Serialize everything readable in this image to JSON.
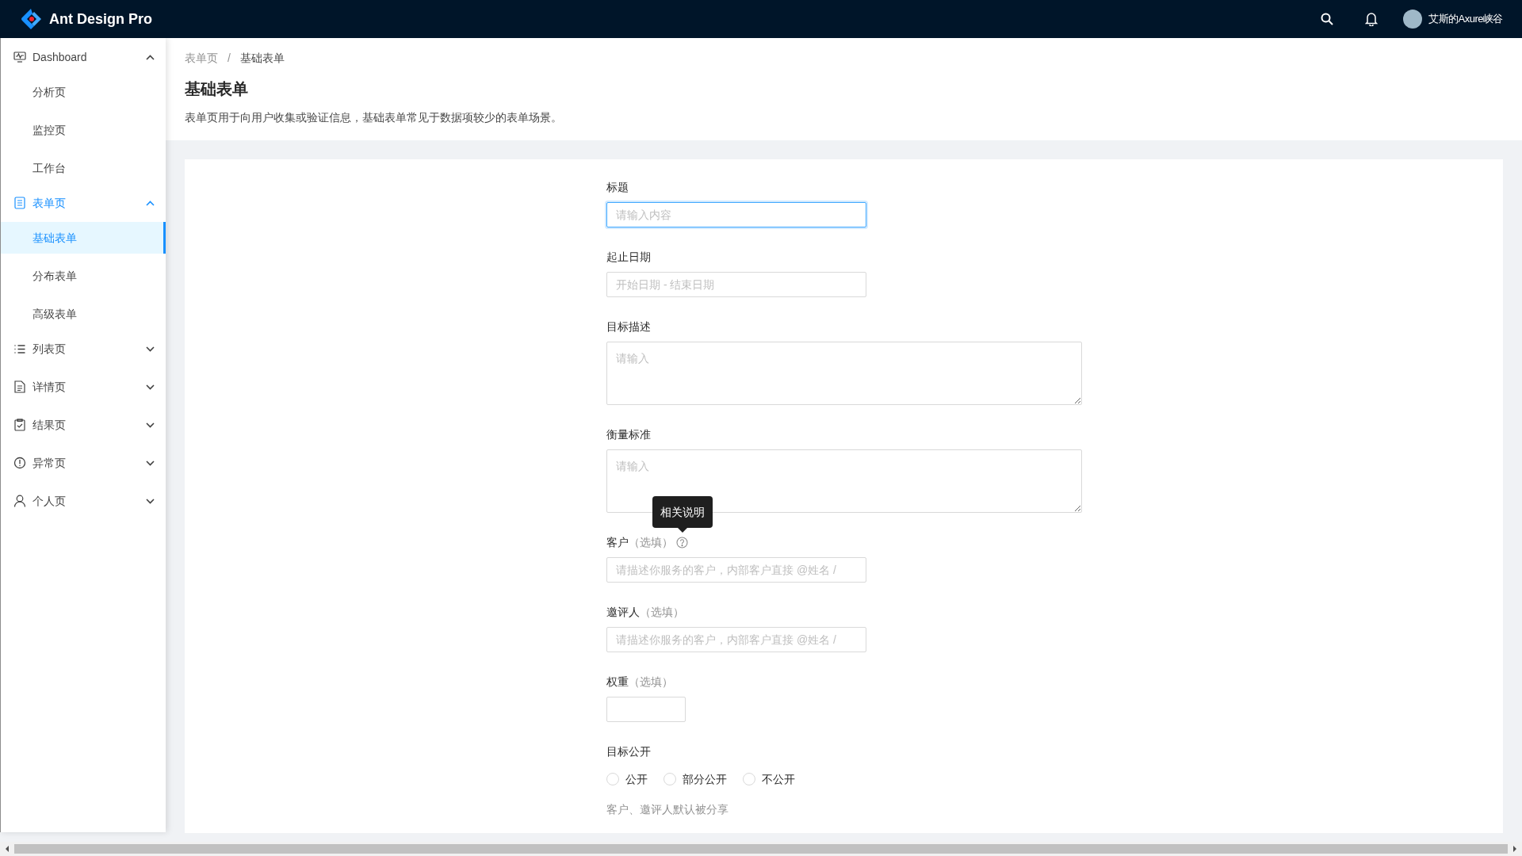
{
  "header": {
    "logo_text": "Ant Design Pro",
    "user_name": "艾斯的Axure峡谷"
  },
  "sidebar": {
    "items": [
      {
        "label": "Dashboard",
        "expanded": true,
        "active": false,
        "children": [
          {
            "label": "分析页",
            "selected": false
          },
          {
            "label": "监控页",
            "selected": false
          },
          {
            "label": "工作台",
            "selected": false
          }
        ]
      },
      {
        "label": "表单页",
        "expanded": true,
        "active": true,
        "children": [
          {
            "label": "基础表单",
            "selected": true
          },
          {
            "label": "分布表单",
            "selected": false
          },
          {
            "label": "高级表单",
            "selected": false
          }
        ]
      },
      {
        "label": "列表页",
        "expanded": false,
        "active": false
      },
      {
        "label": "详情页",
        "expanded": false,
        "active": false
      },
      {
        "label": "结果页",
        "expanded": false,
        "active": false
      },
      {
        "label": "异常页",
        "expanded": false,
        "active": false
      },
      {
        "label": "个人页",
        "expanded": false,
        "active": false
      }
    ]
  },
  "breadcrumb": [
    {
      "label": "表单页",
      "current": false
    },
    {
      "label": "基础表单",
      "current": true
    }
  ],
  "breadcrumb_separator": "/",
  "page_title": "基础表单",
  "page_description": "表单页用于向用户收集或验证信息，基础表单常见于数据项较少的表单场景。",
  "form": {
    "fields": [
      {
        "kind": "input",
        "label": "标题",
        "placeholder": "请输入内容",
        "focused": true
      },
      {
        "kind": "input",
        "label": "起止日期",
        "placeholder": "开始日期 - 结束日期",
        "focused": false
      },
      {
        "kind": "textarea",
        "label": "目标描述",
        "placeholder": "请输入"
      },
      {
        "kind": "textarea",
        "label": "衡量标准",
        "placeholder": "请输入"
      },
      {
        "kind": "input",
        "label": "客户",
        "optional": "（选填）",
        "placeholder": "请描述你服务的客户，内部客户直接 @姓名 / ",
        "focused": false,
        "tooltip": "相关说明"
      },
      {
        "kind": "input",
        "label": "邀评人",
        "optional": "（选填）",
        "placeholder": "请描述你服务的客户，内部客户直接 @姓名 / ",
        "focused": false
      },
      {
        "kind": "number",
        "label": "权重",
        "optional": "（选填）"
      },
      {
        "kind": "radio",
        "label": "目标公开",
        "options": [
          {
            "label": "公开",
            "selected": false
          },
          {
            "label": "部分公开",
            "selected": false
          },
          {
            "label": "不公开",
            "selected": false
          }
        ],
        "help": "客户、邀评人默认被分享"
      }
    ]
  }
}
